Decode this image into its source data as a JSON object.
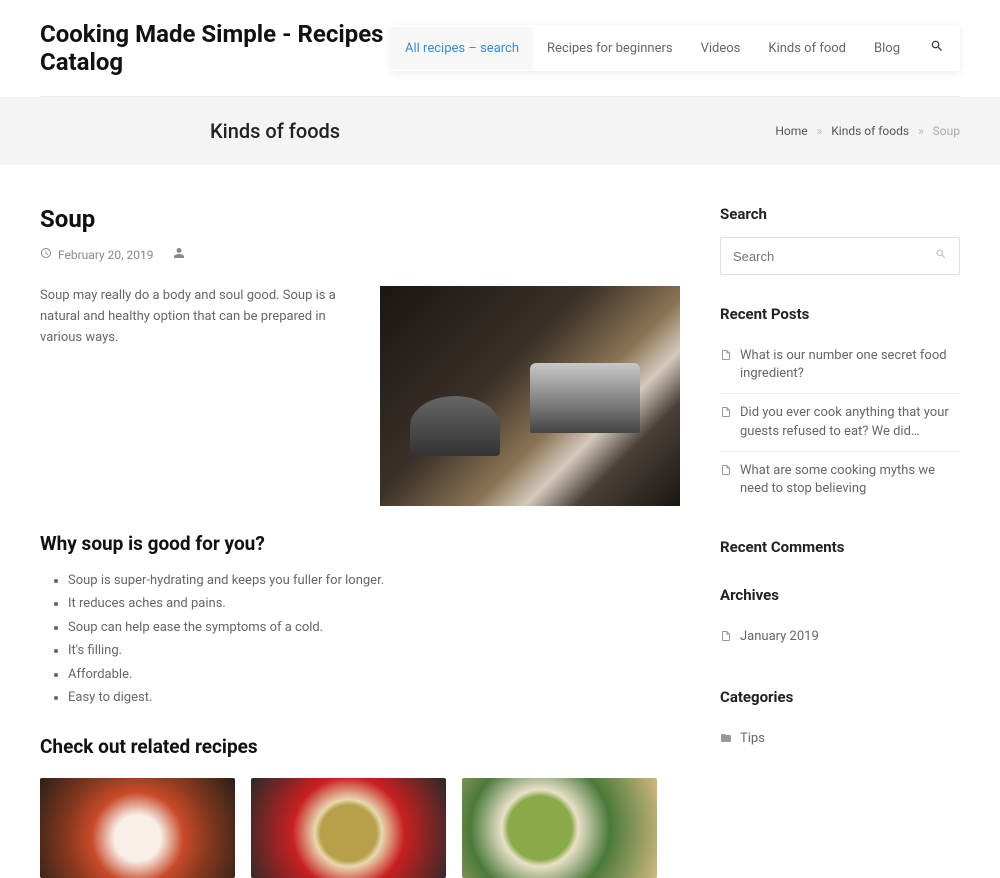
{
  "site_title": "Cooking Made Simple - Recipes Catalog",
  "nav": [
    {
      "label": "All recipes – search",
      "active": true
    },
    {
      "label": "Recipes for beginners"
    },
    {
      "label": "Videos"
    },
    {
      "label": "Kinds of food"
    },
    {
      "label": "Blog"
    }
  ],
  "titlebar": {
    "page_title": "Kinds of foods",
    "breadcrumb": {
      "home": "Home",
      "mid": "Kinds of foods",
      "current": "Soup"
    }
  },
  "article": {
    "title": "Soup",
    "date": "February 20, 2019",
    "intro": "Soup may really do a body and soul good. Soup is a natural and healthy option that can be prepared in various ways.",
    "section1_heading": "Why soup is good for you?",
    "bullets": [
      "Soup is super-hydrating and keeps you fuller for longer.",
      "It reduces aches and pains.",
      "Soup can help ease the symptoms of a cold.",
      "It's filling.",
      "Affordable.",
      "Easy to digest."
    ],
    "related_heading": "Check out related recipes"
  },
  "sidebar": {
    "search_heading": "Search",
    "search_placeholder": "Search",
    "recent_posts_heading": "Recent Posts",
    "recent_posts": [
      "What is our number one secret food ingredient?",
      "Did you ever cook anything that your guests refused to eat? We did…",
      "What are some cooking myths we need to stop believing"
    ],
    "recent_comments_heading": "Recent Comments",
    "archives_heading": "Archives",
    "archives": [
      "January 2019"
    ],
    "categories_heading": "Categories",
    "categories": [
      "Tips"
    ]
  }
}
